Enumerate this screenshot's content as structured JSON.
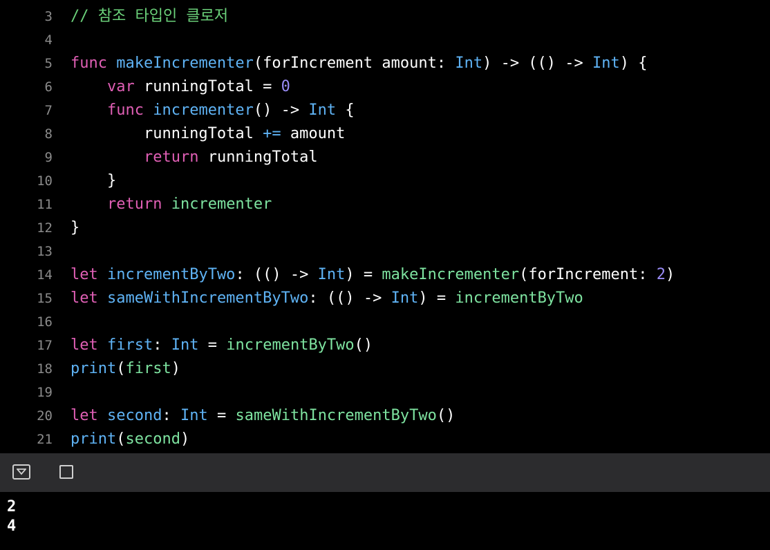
{
  "editor": {
    "lines": [
      {
        "num": "3",
        "tokens": [
          {
            "t": "// 참조 타입인 클로저",
            "c": "cm"
          }
        ]
      },
      {
        "num": "4",
        "tokens": []
      },
      {
        "num": "5",
        "tokens": [
          {
            "t": "func",
            "c": "kw"
          },
          {
            "t": " ",
            "c": "tx"
          },
          {
            "t": "makeIncrementer",
            "c": "ty"
          },
          {
            "t": "(forIncrement amount: ",
            "c": "tx"
          },
          {
            "t": "Int",
            "c": "ty"
          },
          {
            "t": ") -> (() -> ",
            "c": "tx"
          },
          {
            "t": "Int",
            "c": "ty"
          },
          {
            "t": ") {",
            "c": "tx"
          }
        ]
      },
      {
        "num": "6",
        "tokens": [
          {
            "t": "    ",
            "c": "tx"
          },
          {
            "t": "var",
            "c": "kw"
          },
          {
            "t": " runningTotal = ",
            "c": "tx"
          },
          {
            "t": "0",
            "c": "num"
          }
        ]
      },
      {
        "num": "7",
        "tokens": [
          {
            "t": "    ",
            "c": "tx"
          },
          {
            "t": "func",
            "c": "kw"
          },
          {
            "t": " ",
            "c": "tx"
          },
          {
            "t": "incrementer",
            "c": "ty"
          },
          {
            "t": "() -> ",
            "c": "tx"
          },
          {
            "t": "Int",
            "c": "ty"
          },
          {
            "t": " {",
            "c": "tx"
          }
        ]
      },
      {
        "num": "8",
        "tokens": [
          {
            "t": "        runningTotal ",
            "c": "tx"
          },
          {
            "t": "+=",
            "c": "ty"
          },
          {
            "t": " amount",
            "c": "tx"
          }
        ]
      },
      {
        "num": "9",
        "tokens": [
          {
            "t": "        ",
            "c": "tx"
          },
          {
            "t": "return",
            "c": "kw"
          },
          {
            "t": " runningTotal",
            "c": "tx"
          }
        ]
      },
      {
        "num": "10",
        "tokens": [
          {
            "t": "    }",
            "c": "tx"
          }
        ]
      },
      {
        "num": "11",
        "tokens": [
          {
            "t": "    ",
            "c": "tx"
          },
          {
            "t": "return",
            "c": "kw"
          },
          {
            "t": " ",
            "c": "tx"
          },
          {
            "t": "incrementer",
            "c": "fn"
          }
        ]
      },
      {
        "num": "12",
        "tokens": [
          {
            "t": "}",
            "c": "tx"
          }
        ]
      },
      {
        "num": "13",
        "tokens": []
      },
      {
        "num": "14",
        "tokens": [
          {
            "t": "let",
            "c": "kw"
          },
          {
            "t": " ",
            "c": "tx"
          },
          {
            "t": "incrementByTwo",
            "c": "ty"
          },
          {
            "t": ": (() -> ",
            "c": "tx"
          },
          {
            "t": "Int",
            "c": "ty"
          },
          {
            "t": ") = ",
            "c": "tx"
          },
          {
            "t": "makeIncrementer",
            "c": "fn"
          },
          {
            "t": "(forIncrement: ",
            "c": "tx"
          },
          {
            "t": "2",
            "c": "num"
          },
          {
            "t": ")",
            "c": "tx"
          }
        ]
      },
      {
        "num": "15",
        "tokens": [
          {
            "t": "let",
            "c": "kw"
          },
          {
            "t": " ",
            "c": "tx"
          },
          {
            "t": "sameWithIncrementByTwo",
            "c": "ty"
          },
          {
            "t": ": (() -> ",
            "c": "tx"
          },
          {
            "t": "Int",
            "c": "ty"
          },
          {
            "t": ") = ",
            "c": "tx"
          },
          {
            "t": "incrementByTwo",
            "c": "fn"
          }
        ]
      },
      {
        "num": "16",
        "tokens": []
      },
      {
        "num": "17",
        "tokens": [
          {
            "t": "let",
            "c": "kw"
          },
          {
            "t": " ",
            "c": "tx"
          },
          {
            "t": "first",
            "c": "ty"
          },
          {
            "t": ": ",
            "c": "tx"
          },
          {
            "t": "Int",
            "c": "ty"
          },
          {
            "t": " = ",
            "c": "tx"
          },
          {
            "t": "incrementByTwo",
            "c": "fn"
          },
          {
            "t": "()",
            "c": "tx"
          }
        ]
      },
      {
        "num": "18",
        "tokens": [
          {
            "t": "print",
            "c": "ty"
          },
          {
            "t": "(",
            "c": "tx"
          },
          {
            "t": "first",
            "c": "fn"
          },
          {
            "t": ")",
            "c": "tx"
          }
        ]
      },
      {
        "num": "19",
        "tokens": []
      },
      {
        "num": "20",
        "tokens": [
          {
            "t": "let",
            "c": "kw"
          },
          {
            "t": " ",
            "c": "tx"
          },
          {
            "t": "second",
            "c": "ty"
          },
          {
            "t": ": ",
            "c": "tx"
          },
          {
            "t": "Int",
            "c": "ty"
          },
          {
            "t": " = ",
            "c": "tx"
          },
          {
            "t": "sameWithIncrementByTwo",
            "c": "fn"
          },
          {
            "t": "()",
            "c": "tx"
          }
        ]
      },
      {
        "num": "21",
        "tokens": [
          {
            "t": "print",
            "c": "ty"
          },
          {
            "t": "(",
            "c": "tx"
          },
          {
            "t": "second",
            "c": "fn"
          },
          {
            "t": ")",
            "c": "tx"
          }
        ]
      }
    ]
  },
  "console": {
    "toggle_icon": "hide-console-icon",
    "clear_icon": "clear-console-icon",
    "output": [
      "2",
      "4"
    ]
  },
  "colors": {
    "background": "#000000",
    "keyword": "#e05fb5",
    "type": "#5fb3f5",
    "function": "#7ee3a0",
    "number": "#9a8cf7",
    "comment": "#6bd17a",
    "line_number": "#8b8b8b",
    "console_bar": "#2c2c2e"
  }
}
